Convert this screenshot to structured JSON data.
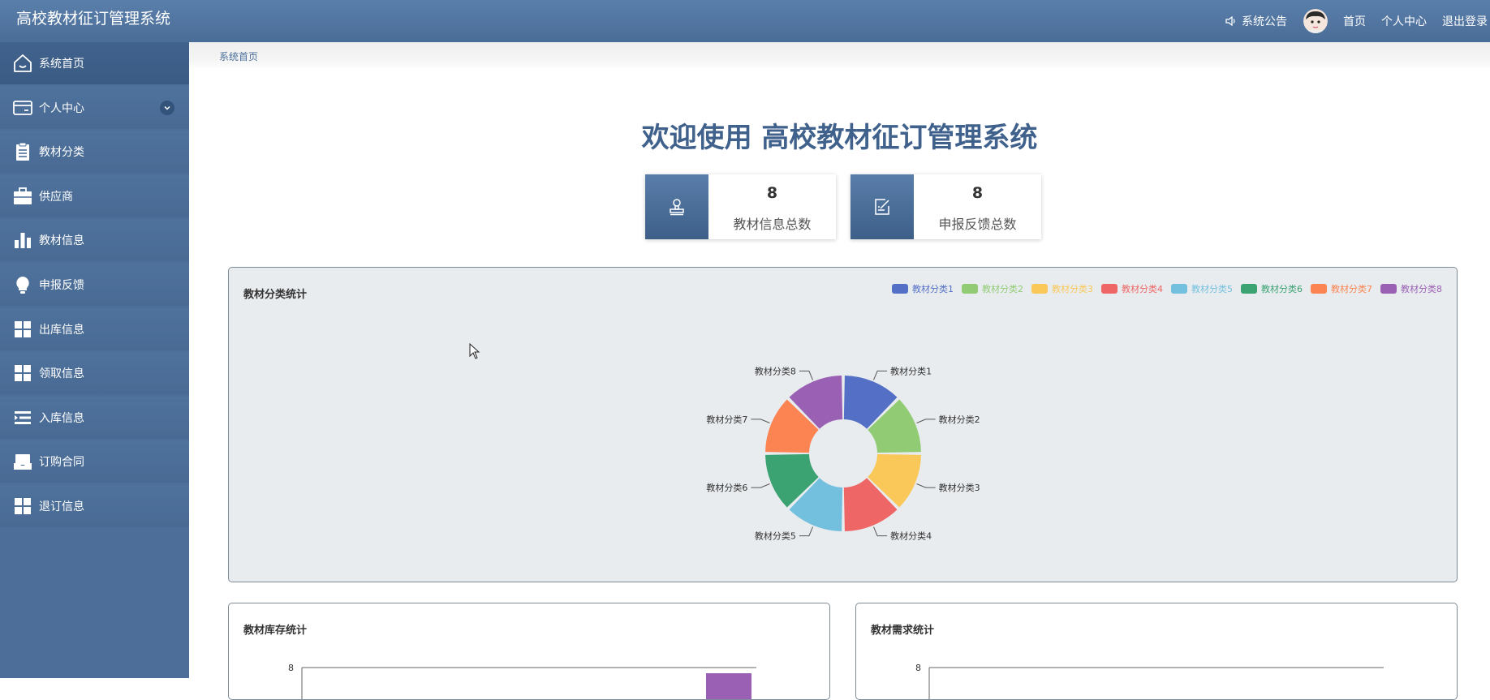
{
  "header": {
    "title": "高校教材征订管理系统",
    "notice": "系统公告",
    "nav": [
      "首页",
      "个人中心",
      "退出登录"
    ]
  },
  "sidebar": {
    "items": [
      {
        "label": "系统首页",
        "icon": "home-icon"
      },
      {
        "label": "个人中心",
        "icon": "wallet-icon"
      },
      {
        "label": "教材分类",
        "icon": "clipboard-icon"
      },
      {
        "label": "供应商",
        "icon": "briefcase-icon"
      },
      {
        "label": "教材信息",
        "icon": "bar-chart-icon"
      },
      {
        "label": "申报反馈",
        "icon": "lightbulb-icon"
      },
      {
        "label": "出库信息",
        "icon": "grid-icon"
      },
      {
        "label": "领取信息",
        "icon": "grid-icon"
      },
      {
        "label": "入库信息",
        "icon": "indent-icon"
      },
      {
        "label": "订购合同",
        "icon": "inbox-icon"
      },
      {
        "label": "退订信息",
        "icon": "grid-icon"
      }
    ]
  },
  "breadcrumb": "系统首页",
  "welcome": "欢迎使用 高校教材征订管理系统",
  "stats": [
    {
      "value": "8",
      "label": "教材信息总数",
      "icon": "stamp-icon"
    },
    {
      "value": "8",
      "label": "申报反馈总数",
      "icon": "edit-note-icon"
    }
  ],
  "colors": {
    "header": "#4f739e",
    "sidebar": "#4c6e98",
    "accent": "#3f618c"
  },
  "panels": {
    "pie_title": "教材分类统计",
    "stock_title": "教材库存统计",
    "demand_title": "教材需求统计"
  },
  "chart_data": [
    {
      "type": "pie",
      "title": "教材分类统计",
      "legend": "top-right",
      "categories": [
        "教材分类1",
        "教材分类2",
        "教材分类3",
        "教材分类4",
        "教材分类5",
        "教材分类6",
        "教材分类7",
        "教材分类8"
      ],
      "values": [
        1,
        1,
        1,
        1,
        1,
        1,
        1,
        1
      ],
      "colors": [
        "#5470c6",
        "#91cc75",
        "#fac858",
        "#ee6666",
        "#73c0de",
        "#3ba272",
        "#fc8452",
        "#9a60b4"
      ]
    },
    {
      "type": "bar",
      "title": "教材库存统计",
      "y_tick_labels": [
        "8"
      ]
    },
    {
      "type": "bar",
      "title": "教材需求统计",
      "y_tick_labels": [
        "8"
      ]
    }
  ]
}
